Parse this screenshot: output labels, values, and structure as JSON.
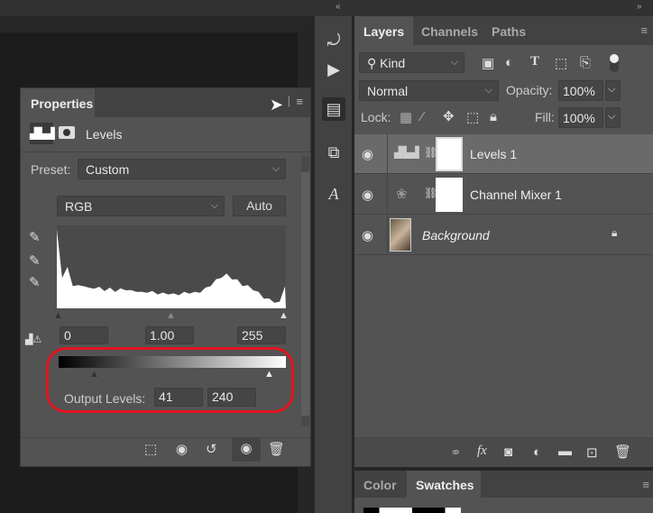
{
  "properties": {
    "title": "Properties",
    "type": "Levels",
    "preset_label": "Preset:",
    "preset_value": "Custom",
    "channel": "RGB",
    "auto_label": "Auto",
    "input_black": "0",
    "input_gamma": "1.00",
    "input_white": "255",
    "output_label": "Output Levels:",
    "output_black": "41",
    "output_white": "240"
  },
  "layers": {
    "tabs": [
      "Layers",
      "Channels",
      "Paths"
    ],
    "filter_kind": "Kind",
    "blend_mode": "Normal",
    "opacity_label": "Opacity:",
    "opacity_value": "100%",
    "lock_label": "Lock:",
    "fill_label": "Fill:",
    "fill_value": "100%",
    "items": [
      {
        "name": "Levels 1"
      },
      {
        "name": "Channel Mixer 1"
      },
      {
        "name": "Background"
      }
    ]
  },
  "bottom_tabs": [
    "Color",
    "Swatches"
  ],
  "colors": {
    "highlight": "#e0141e",
    "panel": "#535353"
  },
  "histogram": [
    0.95,
    0.4,
    0.5,
    0.3,
    0.28,
    0.3,
    0.25,
    0.27,
    0.26,
    0.24,
    0.25,
    0.23,
    0.24,
    0.25,
    0.22,
    0.23,
    0.2,
    0.22,
    0.21,
    0.2,
    0.19,
    0.2,
    0.18,
    0.19,
    0.2,
    0.21,
    0.2,
    0.22,
    0.25,
    0.3,
    0.35,
    0.4,
    0.42,
    0.38,
    0.35,
    0.3,
    0.28,
    0.25,
    0.2,
    0.15,
    0.12,
    0.1,
    0.08,
    0.3
  ]
}
